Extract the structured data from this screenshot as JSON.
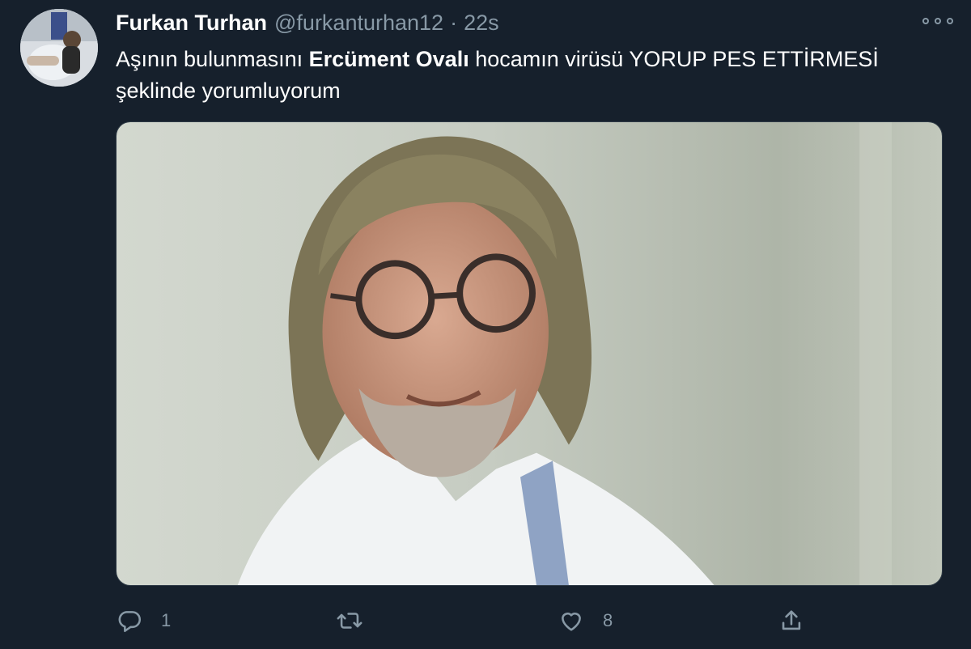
{
  "tweet": {
    "display_name": "Furkan Turhan",
    "handle": "@furkanturhan12",
    "separator": "·",
    "time": "22s",
    "text_before": "Aşının bulunmasını ",
    "text_bold": "Ercüment Ovalı",
    "text_after": " hocamın virüsü YORUP PES ETTİRMESİ şeklinde yorumluyorum",
    "media_icon": "photo-portrait"
  },
  "actions": {
    "reply": {
      "icon": "reply-icon",
      "count": "1"
    },
    "retweet": {
      "icon": "retweet-icon",
      "count": ""
    },
    "like": {
      "icon": "heart-icon",
      "count": "8"
    },
    "share": {
      "icon": "share-icon",
      "count": ""
    }
  },
  "colors": {
    "background": "#16202c",
    "secondary_text": "#8899a6",
    "primary_text": "#ffffff"
  }
}
